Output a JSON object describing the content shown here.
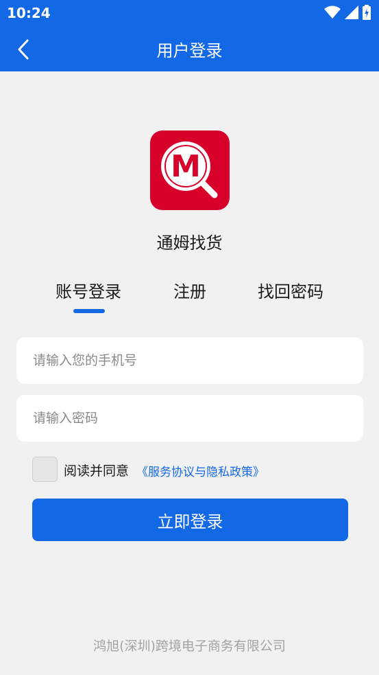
{
  "status_bar": {
    "time": "10:24",
    "icons": [
      "wifi-icon",
      "signal-icon",
      "battery-icon"
    ]
  },
  "nav": {
    "back_icon": "chevron-left-icon",
    "title": "用户登录"
  },
  "app": {
    "logo_icon": "magnifier-m-logo",
    "logo_letter": "M",
    "name": "通姆找货"
  },
  "tabs": [
    {
      "label": "账号登录",
      "active": true
    },
    {
      "label": "注册",
      "active": false
    },
    {
      "label": "找回密码",
      "active": false
    }
  ],
  "form": {
    "phone": {
      "value": "",
      "placeholder": "请输入您的手机号"
    },
    "password": {
      "value": "",
      "placeholder": "请输入密码"
    },
    "agree": {
      "checked": false,
      "text": "阅读并同意",
      "link": "《服务协议与隐私政策》"
    },
    "submit_label": "立即登录"
  },
  "footer": {
    "company": "鸿旭(深圳)跨境电子商务有限公司"
  },
  "colors": {
    "primary": "#1368e6",
    "logo_red": "#d7002a",
    "background": "#f1f1f1"
  }
}
